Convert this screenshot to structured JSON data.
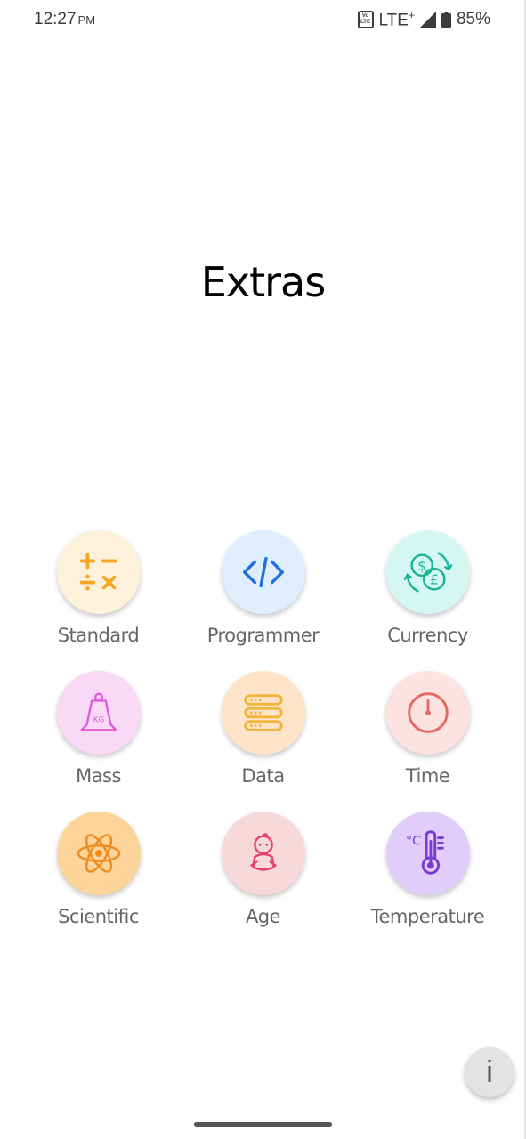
{
  "status_bar": {
    "time": "12:27",
    "ampm": "PM",
    "volte_top": "Vo",
    "volte_bottom": "LTE",
    "network": "LTE",
    "network_sup": "+",
    "battery": "85%"
  },
  "title": "Extras",
  "tiles": [
    {
      "label": "Standard",
      "icon": "calculator-operators-icon",
      "bg": "#fdf1dc",
      "color": "#f5a623"
    },
    {
      "label": "Programmer",
      "icon": "code-brackets-icon",
      "bg": "#dfeefd",
      "color": "#1e6fe0"
    },
    {
      "label": "Currency",
      "icon": "currency-exchange-icon",
      "bg": "#d4f7f1",
      "color": "#1ab394"
    },
    {
      "label": "Mass",
      "icon": "weight-kg-icon",
      "bg": "#f9d9f6",
      "color": "#e25cdc",
      "icon_text": "KG"
    },
    {
      "label": "Data",
      "icon": "data-storage-icon",
      "bg": "#fde3c7",
      "color": "#efb63a"
    },
    {
      "label": "Time",
      "icon": "clock-icon",
      "bg": "#fce3e1",
      "color": "#e46a62"
    },
    {
      "label": "Scientific",
      "icon": "atom-icon",
      "bg": "#fdd59a",
      "color": "#f08c1f"
    },
    {
      "label": "Age",
      "icon": "baby-icon",
      "bg": "#f8d9db",
      "color": "#e2456a"
    },
    {
      "label": "Temperature",
      "icon": "thermometer-celsius-icon",
      "bg": "#e1cdfa",
      "color": "#7a3ad6",
      "icon_text": "°C"
    }
  ],
  "info_button": "i"
}
